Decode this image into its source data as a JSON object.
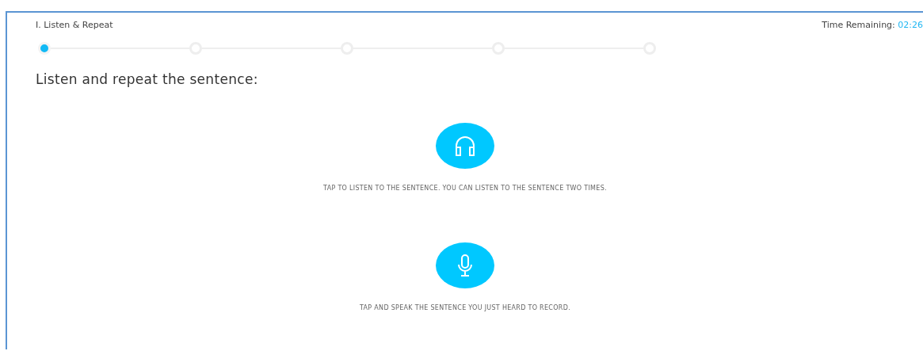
{
  "section_title": "I. Listen & Repeat",
  "timer": {
    "label": "Time Remaining:",
    "value": "02:26"
  },
  "steps": [
    {
      "selected": true
    },
    {
      "selected": false
    },
    {
      "selected": false
    },
    {
      "selected": false
    },
    {
      "selected": false
    }
  ],
  "instruction": "Listen and repeat the sentence:",
  "actions": [
    {
      "kind": "listen",
      "caption": "TAP TO LISTEN TO THE SENTENCE. YOU CAN LISTEN TO THE SENTENCE TWO TIMES."
    },
    {
      "kind": "record",
      "caption": "TAP AND SPEAK THE SENTENCE YOU JUST HEARD TO RECORD."
    }
  ]
}
